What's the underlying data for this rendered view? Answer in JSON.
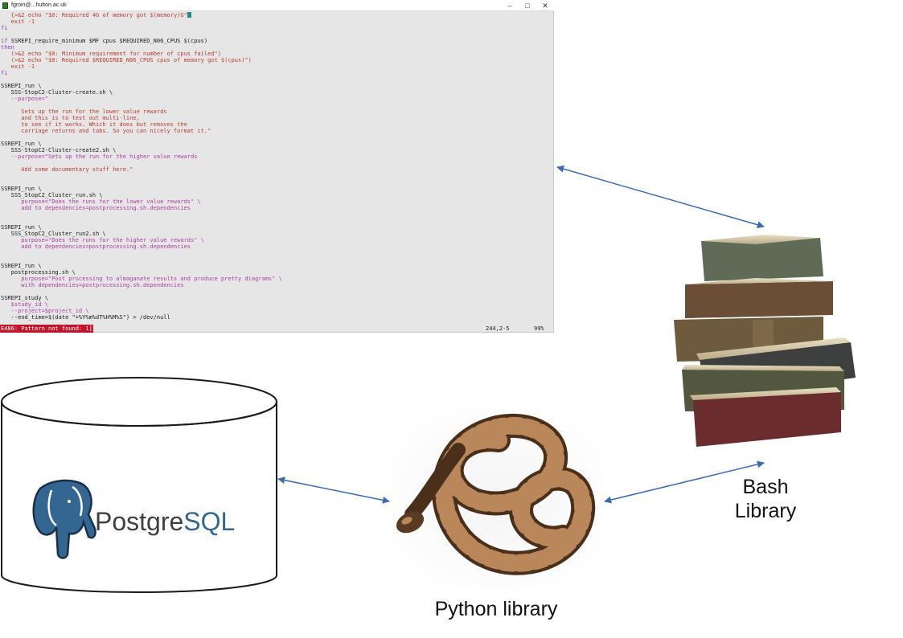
{
  "terminal": {
    "title": "fgroin@...hutton.ac.uk",
    "window_controls": [
      "–",
      "□",
      "✕"
    ],
    "status_error": "E486: Pattern not found: 1]",
    "status_position": "244,2-5",
    "status_percent": "99%",
    "lines": [
      [
        [
          "   ",
          "n"
        ],
        [
          "{>&2 echo ",
          "s"
        ],
        [
          "\"$0: Required 4G of memory got $(memory)G\"",
          "s"
        ],
        [
          "CURSOR",
          ""
        ]
      ],
      [
        [
          "   exit -1",
          "s"
        ]
      ],
      [
        [
          "fi",
          "k"
        ]
      ],
      [
        [
          "",
          ""
        ]
      ],
      [
        [
          "if ",
          "k"
        ],
        [
          "SSREPI_require_minimum $MF cpus $REQUIRED_N06_CPUS $(cpus)",
          "n"
        ]
      ],
      [
        [
          "then",
          "k"
        ]
      ],
      [
        [
          "   (>&2 echo \"$0: Minimum requirement for number of cpus failed\")",
          "s"
        ]
      ],
      [
        [
          "   (>&2 echo \"$0: Required $REQUIRED_N06_CPUS cpus of memory got $(cpus)\")",
          "s"
        ]
      ],
      [
        [
          "   exit -1",
          "s"
        ]
      ],
      [
        [
          "fi",
          "k"
        ]
      ],
      [
        [
          "",
          ""
        ]
      ],
      [
        [
          "SSREPI_run \\",
          "n"
        ]
      ],
      [
        [
          "   SSS-StopC2-Cluster-create.sh \\",
          "n"
        ]
      ],
      [
        [
          "   --purpose=\"",
          "v"
        ]
      ],
      [
        [
          "",
          ""
        ]
      ],
      [
        [
          "      Sets up the run for the lower value rewards",
          "s"
        ]
      ],
      [
        [
          "      and this is to test out multi-line,",
          "s"
        ]
      ],
      [
        [
          "      to see if it works. Which it does but removes the",
          "s"
        ]
      ],
      [
        [
          "      carriage returns and tabs. So you can nicely format it.\"",
          "s"
        ]
      ],
      [
        [
          "",
          ""
        ]
      ],
      [
        [
          "SSREPI_run \\",
          "n"
        ]
      ],
      [
        [
          "   SSS-StopC2-Cluster-create2.sh \\",
          "n"
        ]
      ],
      [
        [
          "   --purpose=\"Sets up the run for the higher value rewards",
          "v"
        ]
      ],
      [
        [
          "",
          ""
        ]
      ],
      [
        [
          "      Add some documentary stuff here.\"",
          "s"
        ]
      ],
      [
        [
          "",
          ""
        ]
      ],
      [
        [
          "",
          ""
        ]
      ],
      [
        [
          "SSREPI_run \\",
          "n"
        ]
      ],
      [
        [
          "   SSS_StopC2_Cluster_run.sh \\",
          "n"
        ]
      ],
      [
        [
          "      purpose=\"Does the runs for the lower value rewards\" \\",
          "v"
        ]
      ],
      [
        [
          "      add to dependencies=postprocessing.sh.dependencies",
          "v"
        ]
      ],
      [
        [
          "",
          ""
        ]
      ],
      [
        [
          "",
          ""
        ]
      ],
      [
        [
          "SSREPI_run \\",
          "n"
        ]
      ],
      [
        [
          "   SSS_StopC2_Cluster_run2.sh \\",
          "n"
        ]
      ],
      [
        [
          "      purpose=\"Does the runs for the higher value rewards\" \\",
          "v"
        ]
      ],
      [
        [
          "      add to dependencies=postprocessing.sh.dependencies",
          "v"
        ]
      ],
      [
        [
          "",
          ""
        ]
      ],
      [
        [
          "",
          ""
        ]
      ],
      [
        [
          "SSREPI_run \\",
          "n"
        ]
      ],
      [
        [
          "   postprocessing.sh \\",
          "n"
        ]
      ],
      [
        [
          "      purpose=\"Post processing to almaganate results and produce pretty diagrams\" \\",
          "v"
        ]
      ],
      [
        [
          "      with dependencies=postprocessing.sh.dependencies",
          "v"
        ]
      ],
      [
        [
          "",
          ""
        ]
      ],
      [
        [
          "SSREPI_study \\",
          "n"
        ]
      ],
      [
        [
          "   $study_id \\",
          "v"
        ]
      ],
      [
        [
          "   --project=$project_id \\",
          "v"
        ]
      ],
      [
        [
          "   --end_time=$(date \"+%Y%m%dT%H%M%S\") > /dev/null",
          "n"
        ]
      ]
    ]
  },
  "nodes": {
    "postgres": {
      "label_prefix": "Postgre",
      "label_suffix": "SQL",
      "color_prefix": "#3f3f3f",
      "color_suffix": "#336791"
    },
    "python": {
      "label": "Python library"
    },
    "bash": {
      "label_line1": "Bash",
      "label_line2": "Library"
    }
  },
  "colors": {
    "arrow": "#3a6bb5",
    "elephant": "#336791"
  },
  "icons": [
    "terminal-app-icon",
    "database-cylinder-icon",
    "postgresql-elephant-icon",
    "python-snake-image",
    "books-stack-image"
  ]
}
